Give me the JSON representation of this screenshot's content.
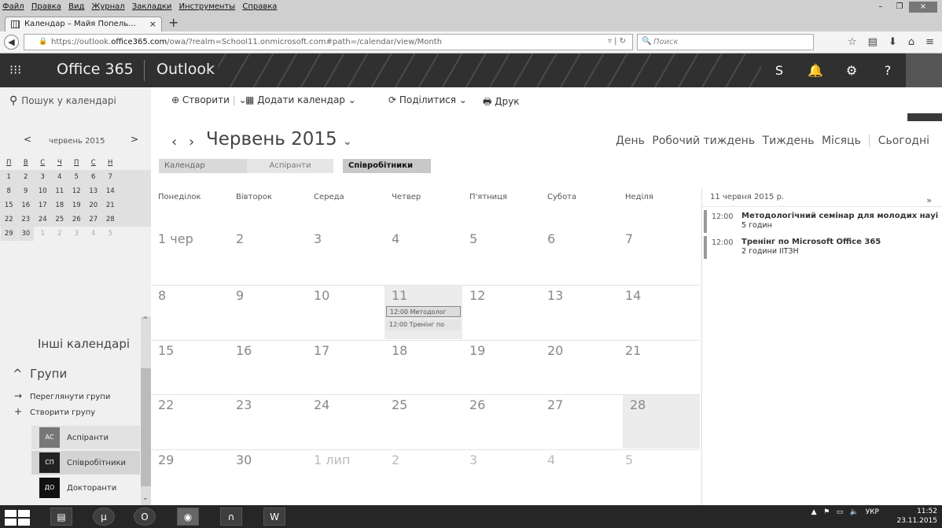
{
  "browser": {
    "menu": [
      "Файл",
      "Правка",
      "Вид",
      "Журнал",
      "Закладки",
      "Инструменты",
      "Справка"
    ],
    "tab_title": "Календар – Майя Попель...",
    "tab_close": "×",
    "new_tab": "+",
    "url_prefix": "https://outlook.",
    "url_domain": "office365.com",
    "url_rest": "/owa/?realm=School11.onmicrosoft.com#path=/calendar/view/Month",
    "search_placeholder": "Поиск"
  },
  "header": {
    "app_name": "Office 365",
    "product": "Outlook"
  },
  "toolbar": {
    "search": "Пошук у календарі",
    "create": "Створити",
    "add_calendar": "Додати календар",
    "share": "Поділитися",
    "print": "Друк"
  },
  "minical": {
    "label": "червень 2015",
    "weekdays": [
      "П",
      "В",
      "С",
      "Ч",
      "П",
      "С",
      "Н"
    ],
    "weeks": [
      [
        "1",
        "2",
        "3",
        "4",
        "5",
        "6",
        "7"
      ],
      [
        "8",
        "9",
        "10",
        "11",
        "12",
        "13",
        "14"
      ],
      [
        "15",
        "16",
        "17",
        "18",
        "19",
        "20",
        "21"
      ],
      [
        "22",
        "23",
        "24",
        "25",
        "26",
        "27",
        "28"
      ],
      [
        "29",
        "30",
        "1",
        "2",
        "3",
        "4",
        "5"
      ]
    ]
  },
  "sidebar": {
    "other_calendars": "Інші календарі",
    "groups": "Групи",
    "browse_groups": "Переглянути групи",
    "create_group": "Створити групу",
    "group_items": [
      {
        "abbr": "АС",
        "label": "Аспіранти"
      },
      {
        "abbr": "СП",
        "label": "Співробітники"
      },
      {
        "abbr": "ДО",
        "label": "Докторанти"
      }
    ]
  },
  "calendar": {
    "title": "Червень 2015",
    "views": [
      "День",
      "Робочий тиждень",
      "Тиждень",
      "Місяць"
    ],
    "today": "Сьогодні",
    "tabs": [
      "Календар",
      "Аспіранти",
      "Співробітники"
    ],
    "day_headers": [
      "Понеділок",
      "Вівторок",
      "Середа",
      "Четвер",
      "П'ятниця",
      "Субота",
      "Неділя"
    ],
    "weeks": [
      [
        "1 чер",
        "2",
        "3",
        "4",
        "5",
        "6",
        "7"
      ],
      [
        "8",
        "9",
        "10",
        "11",
        "12",
        "13",
        "14"
      ],
      [
        "15",
        "16",
        "17",
        "18",
        "19",
        "20",
        "21"
      ],
      [
        "22",
        "23",
        "24",
        "25",
        "26",
        "27",
        "28"
      ],
      [
        "29",
        "30",
        "1 лип",
        "2",
        "3",
        "4",
        "5"
      ]
    ],
    "cell_events": [
      "12:00 Методолог",
      "12:00 Тренінг по"
    ]
  },
  "day_panel": {
    "date": "11 червня 2015 р.",
    "next": "»",
    "events": [
      {
        "time": "12:00",
        "title": "Методологічний семінар для молодих науі",
        "detail": "5 годин"
      },
      {
        "time": "12:00",
        "title": "Тренінг по Microsoft Office 365",
        "detail": "2 години  ІІТЗН"
      }
    ]
  },
  "taskbar": {
    "lang": "УКР",
    "time": "11:52",
    "date": "23.11.2015"
  }
}
